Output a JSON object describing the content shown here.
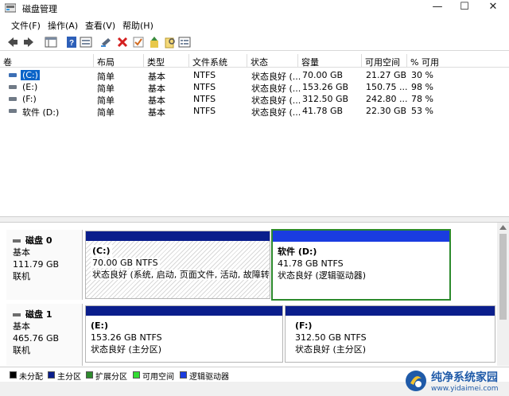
{
  "window": {
    "title": "磁盘管理",
    "min": "—",
    "max": "☐",
    "close": "✕"
  },
  "menu": [
    "文件(F)",
    "操作(A)",
    "查看(V)",
    "帮助(H)"
  ],
  "toolbar": [
    "back-icon",
    "forward-icon",
    "show-hide-tree-icon",
    "help-icon",
    "properties-icon",
    "connect-icon",
    "delete-icon",
    "check-icon",
    "wizard-icon",
    "search-icon",
    "list-icon"
  ],
  "list": {
    "columns": [
      "卷",
      "布局",
      "类型",
      "文件系统",
      "状态",
      "容量",
      "可用空间",
      "% 可用"
    ],
    "rows": [
      {
        "vol": "(C:)",
        "layout": "简单",
        "type": "基本",
        "fs": "NTFS",
        "status": "状态良好 (...",
        "cap": "70.00 GB",
        "free": "21.27 GB",
        "pct": "30 %"
      },
      {
        "vol": "(E:)",
        "layout": "简单",
        "type": "基本",
        "fs": "NTFS",
        "status": "状态良好 (...",
        "cap": "153.26 GB",
        "free": "150.75 ...",
        "pct": "98 %"
      },
      {
        "vol": "(F:)",
        "layout": "简单",
        "type": "基本",
        "fs": "NTFS",
        "status": "状态良好 (...",
        "cap": "312.50 GB",
        "free": "242.80 ...",
        "pct": "78 %"
      },
      {
        "vol": "软件 (D:)",
        "layout": "简单",
        "type": "基本",
        "fs": "NTFS",
        "status": "状态良好 (...",
        "cap": "41.78 GB",
        "free": "22.30 GB",
        "pct": "53 %"
      }
    ]
  },
  "disks": [
    {
      "name": "磁盘 0",
      "kind": "基本",
      "size": "111.79 GB",
      "state": "联机",
      "partitions": [
        {
          "title": "(C:)",
          "size": "70.00 GB NTFS",
          "status": "状态良好 (系统, 启动, 页面文件, 活动, 故障转储, 主分区)"
        },
        {
          "title": "软件  (D:)",
          "size": "41.78 GB NTFS",
          "status": "状态良好 (逻辑驱动器)"
        }
      ]
    },
    {
      "name": "磁盘 1",
      "kind": "基本",
      "size": "465.76 GB",
      "state": "联机",
      "partitions": [
        {
          "title": "(E:)",
          "size": "153.26 GB NTFS",
          "status": "状态良好 (主分区)"
        },
        {
          "title": "(F:)",
          "size": "312.50 GB NTFS",
          "status": "状态良好 (主分区)"
        }
      ]
    }
  ],
  "legend": [
    {
      "label": "未分配",
      "color": "#000000"
    },
    {
      "label": "主分区",
      "color": "#0a1e8c"
    },
    {
      "label": "扩展分区",
      "color": "#2e8b2e"
    },
    {
      "label": "可用空间",
      "color": "#33dd33"
    },
    {
      "label": "逻辑驱动器",
      "color": "#1a3ce0"
    }
  ],
  "colors": {
    "primary_bar": "#0a1e8c",
    "logical_bar": "#1a3ce0",
    "selection": "#0a64c8",
    "extended_border": "#2c8a2c"
  },
  "watermark": {
    "name": "纯净系统家园",
    "url": "www.yidaimei.com"
  }
}
